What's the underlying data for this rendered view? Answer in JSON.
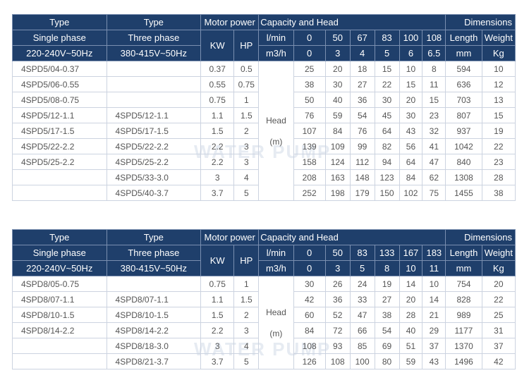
{
  "tables": [
    {
      "header": {
        "type1": "Type",
        "type2": "Type",
        "motor": "Motor power",
        "capacity": "Capacity and Head",
        "dimensions": "Dimensions",
        "single": "Single phase",
        "three": "Three phase",
        "kw": "KW",
        "hp": "HP",
        "lmin": "l/min",
        "flow_lmin": [
          "0",
          "50",
          "67",
          "83",
          "100",
          "108"
        ],
        "length": "Length",
        "weight": "Weight",
        "v1": "220-240V~50Hz",
        "v2": "380-415V~50Hz",
        "m3h": "m3/h",
        "flow_m3h": [
          "0",
          "3",
          "4",
          "5",
          "6",
          "6.5"
        ],
        "mm": "mm",
        "kg": "Kg"
      },
      "head_label": "Head",
      "head_unit": "(m)",
      "rows": [
        [
          "4SPD5/04-0.37",
          "",
          "0.37",
          "0.5",
          "25",
          "20",
          "18",
          "15",
          "10",
          "8",
          "594",
          "10"
        ],
        [
          "4SPD5/06-0.55",
          "",
          "0.55",
          "0.75",
          "38",
          "30",
          "27",
          "22",
          "15",
          "11",
          "636",
          "12"
        ],
        [
          "4SPD5/08-0.75",
          "",
          "0.75",
          "1",
          "50",
          "40",
          "36",
          "30",
          "20",
          "15",
          "703",
          "13"
        ],
        [
          "4SPD5/12-1.1",
          "4SPD5/12-1.1",
          "1.1",
          "1.5",
          "76",
          "59",
          "54",
          "45",
          "30",
          "23",
          "807",
          "15"
        ],
        [
          "4SPD5/17-1.5",
          "4SPD5/17-1.5",
          "1.5",
          "2",
          "107",
          "84",
          "76",
          "64",
          "43",
          "32",
          "937",
          "19"
        ],
        [
          "4SPD5/22-2.2",
          "4SPD5/22-2.2",
          "2.2",
          "3",
          "139",
          "109",
          "99",
          "82",
          "56",
          "41",
          "1042",
          "22"
        ],
        [
          "4SPD5/25-2.2",
          "4SPD5/25-2.2",
          "2.2",
          "3",
          "158",
          "124",
          "112",
          "94",
          "64",
          "47",
          "840",
          "23"
        ],
        [
          "",
          "4SPD5/33-3.0",
          "3",
          "4",
          "208",
          "163",
          "148",
          "123",
          "84",
          "62",
          "1308",
          "28"
        ],
        [
          "",
          "4SPD5/40-3.7",
          "3.7",
          "5",
          "252",
          "198",
          "179",
          "150",
          "102",
          "75",
          "1455",
          "38"
        ]
      ]
    },
    {
      "header": {
        "type1": "Type",
        "type2": "Type",
        "motor": "Motor power",
        "capacity": "Capacity and Head",
        "dimensions": "Dimensions",
        "single": "Single phase",
        "three": "Three phase",
        "kw": "KW",
        "hp": "HP",
        "lmin": "l/min",
        "flow_lmin": [
          "0",
          "50",
          "83",
          "133",
          "167",
          "183"
        ],
        "length": "Length",
        "weight": "Weight",
        "v1": "220-240V~50Hz",
        "v2": "380-415V~50Hz",
        "m3h": "m3/h",
        "flow_m3h": [
          "0",
          "3",
          "5",
          "8",
          "10",
          "11"
        ],
        "mm": "mm",
        "kg": "Kg"
      },
      "head_label": "Head",
      "head_unit": "(m)",
      "rows": [
        [
          "4SPD8/05-0.75",
          "",
          "0.75",
          "1",
          "30",
          "26",
          "24",
          "19",
          "14",
          "10",
          "754",
          "20"
        ],
        [
          "4SPD8/07-1.1",
          "4SPD8/07-1.1",
          "1.1",
          "1.5",
          "42",
          "36",
          "33",
          "27",
          "20",
          "14",
          "828",
          "22"
        ],
        [
          "4SPD8/10-1.5",
          "4SPD8/10-1.5",
          "1.5",
          "2",
          "60",
          "52",
          "47",
          "38",
          "28",
          "21",
          "989",
          "25"
        ],
        [
          "4SPD8/14-2.2",
          "4SPD8/14-2.2",
          "2.2",
          "3",
          "84",
          "72",
          "66",
          "54",
          "40",
          "29",
          "1177",
          "31"
        ],
        [
          "",
          "4SPD8/18-3.0",
          "3",
          "4",
          "108",
          "93",
          "85",
          "69",
          "51",
          "37",
          "1370",
          "37"
        ],
        [
          "",
          "4SPD8/21-3.7",
          "3.7",
          "5",
          "126",
          "108",
          "100",
          "80",
          "59",
          "43",
          "1496",
          "42"
        ]
      ]
    }
  ]
}
